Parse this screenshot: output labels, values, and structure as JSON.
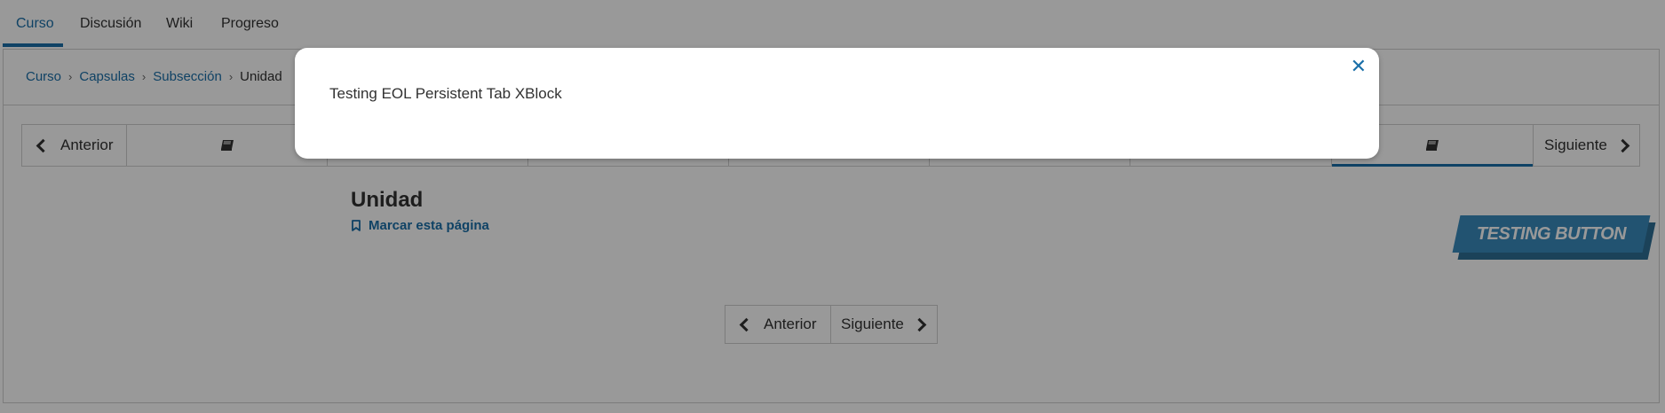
{
  "tabs": [
    {
      "label": "Curso",
      "active": true
    },
    {
      "label": "Discusión",
      "active": false
    },
    {
      "label": "Wiki",
      "active": false
    },
    {
      "label": "Progreso",
      "active": false
    }
  ],
  "breadcrumb": {
    "items": [
      "Curso",
      "Capsulas",
      "Subsección"
    ],
    "current": "Unidad",
    "separator": "›"
  },
  "sequence_nav": {
    "prev_label": "Anterior",
    "next_label": "Siguiente",
    "unit_icon": "book-icon",
    "active_unit": 8
  },
  "unit": {
    "title": "Unidad",
    "bookmark_label": "Marcar esta página"
  },
  "testing_button": {
    "label": "TESTING BUTTON"
  },
  "bottom_nav": {
    "prev_label": "Anterior",
    "next_label": "Siguiente"
  },
  "modal": {
    "text": "Testing EOL Persistent Tab XBlock",
    "close_icon": "close-icon"
  },
  "colors": {
    "accent": "#1a6fa8",
    "testing_button": "#3a8bbd",
    "overlay": "rgba(0,0,0,0.40)"
  }
}
